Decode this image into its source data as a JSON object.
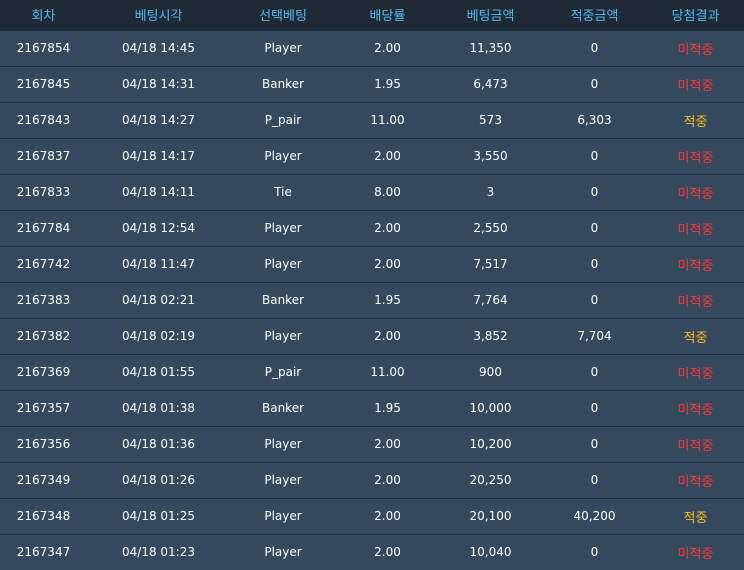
{
  "headers": [
    "회차",
    "베팅시각",
    "선택베팅",
    "배당률",
    "베팅금액",
    "적중금액",
    "당첨결과"
  ],
  "rows": [
    {
      "round": "2167854",
      "time": "04/18 14:45",
      "choice": "Player",
      "odds": "2.00",
      "bet": "11,350",
      "win": "0",
      "result": "미적중",
      "status": "lose"
    },
    {
      "round": "2167845",
      "time": "04/18 14:31",
      "choice": "Banker",
      "odds": "1.95",
      "bet": "6,473",
      "win": "0",
      "result": "미적중",
      "status": "lose"
    },
    {
      "round": "2167843",
      "time": "04/18 14:27",
      "choice": "P_pair",
      "odds": "11.00",
      "bet": "573",
      "win": "6,303",
      "result": "적중",
      "status": "win"
    },
    {
      "round": "2167837",
      "time": "04/18 14:17",
      "choice": "Player",
      "odds": "2.00",
      "bet": "3,550",
      "win": "0",
      "result": "미적중",
      "status": "lose"
    },
    {
      "round": "2167833",
      "time": "04/18 14:11",
      "choice": "Tie",
      "odds": "8.00",
      "bet": "3",
      "win": "0",
      "result": "미적중",
      "status": "lose"
    },
    {
      "round": "2167784",
      "time": "04/18 12:54",
      "choice": "Player",
      "odds": "2.00",
      "bet": "2,550",
      "win": "0",
      "result": "미적중",
      "status": "lose"
    },
    {
      "round": "2167742",
      "time": "04/18 11:47",
      "choice": "Player",
      "odds": "2.00",
      "bet": "7,517",
      "win": "0",
      "result": "미적중",
      "status": "lose"
    },
    {
      "round": "2167383",
      "time": "04/18 02:21",
      "choice": "Banker",
      "odds": "1.95",
      "bet": "7,764",
      "win": "0",
      "result": "미적중",
      "status": "lose"
    },
    {
      "round": "2167382",
      "time": "04/18 02:19",
      "choice": "Player",
      "odds": "2.00",
      "bet": "3,852",
      "win": "7,704",
      "result": "적중",
      "status": "win"
    },
    {
      "round": "2167369",
      "time": "04/18 01:55",
      "choice": "P_pair",
      "odds": "11.00",
      "bet": "900",
      "win": "0",
      "result": "미적중",
      "status": "lose"
    },
    {
      "round": "2167357",
      "time": "04/18 01:38",
      "choice": "Banker",
      "odds": "1.95",
      "bet": "10,000",
      "win": "0",
      "result": "미적중",
      "status": "lose"
    },
    {
      "round": "2167356",
      "time": "04/18 01:36",
      "choice": "Player",
      "odds": "2.00",
      "bet": "10,200",
      "win": "0",
      "result": "미적중",
      "status": "lose"
    },
    {
      "round": "2167349",
      "time": "04/18 01:26",
      "choice": "Player",
      "odds": "2.00",
      "bet": "20,250",
      "win": "0",
      "result": "미적중",
      "status": "lose"
    },
    {
      "round": "2167348",
      "time": "04/18 01:25",
      "choice": "Player",
      "odds": "2.00",
      "bet": "20,100",
      "win": "40,200",
      "result": "적중",
      "status": "win"
    },
    {
      "round": "2167347",
      "time": "04/18 01:23",
      "choice": "Player",
      "odds": "2.00",
      "bet": "10,040",
      "win": "0",
      "result": "미적중",
      "status": "lose"
    }
  ],
  "colors": {
    "header_bg": "#1f2a35",
    "header_text": "#55b9f3",
    "row_bg": "#34495e",
    "row_border": "#22313f",
    "text": "#ffffff",
    "lose": "#ff3838",
    "win": "#ffbd1c"
  }
}
